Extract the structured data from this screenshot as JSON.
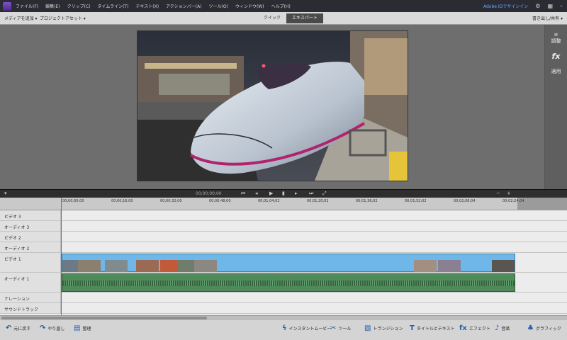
{
  "menubar": {
    "items": [
      "ファイル(F)",
      "編集(E)",
      "クリップ(C)",
      "タイムライン(T)",
      "テキスト(X)",
      "アクションバー(A)",
      "ツール(O)",
      "ウィンドウ(W)",
      "ヘルプ(H)"
    ],
    "signin": "Adobe IDでサインイン",
    "icons": [
      "settings-icon",
      "grid-icon",
      "minimize-icon"
    ]
  },
  "modebar": {
    "media_dropdown": "メディアを追加 ▾",
    "project_dropdown": "プロジェクトアセット ▾",
    "tab_quick": "クイック",
    "tab_expert": "エキスパート",
    "share_dropdown": "書き出し/共有 ▾"
  },
  "right_tools": {
    "adjust": "調整",
    "fx": "fx",
    "apply": "適用"
  },
  "transport": {
    "timecode": "00;00;00;00"
  },
  "ruler": {
    "ticks": [
      "00;00;00;00",
      "00;00;16;00",
      "00;00;32;00",
      "00;00;48;00",
      "00;01;04;02",
      "00;01;20;02",
      "00;01;36;02",
      "00;01;52;02",
      "00;02;08;04",
      "00;02;24;04"
    ]
  },
  "tracks": [
    {
      "label": "ビデオ 3"
    },
    {
      "label": "オーディオ 3"
    },
    {
      "label": "ビデオ 2"
    },
    {
      "label": "オーディオ 2"
    },
    {
      "label": "ビデオ 1"
    },
    {
      "label": "オーディオ 1"
    },
    {
      "label": "ナレーション"
    },
    {
      "label": "サウンドトラック"
    }
  ],
  "footer": {
    "undo": "元に戻す",
    "redo": "やり直し",
    "organizer": "整理",
    "instant_movie": "インスタントムービー",
    "tools": "ツール",
    "transitions": "トランジション",
    "titles": "タイトルとテキスト",
    "effects": "エフェクト",
    "audio": "音楽",
    "graphics": "グラフィック"
  },
  "colors": {
    "video_clip": "#6fb7e8",
    "audio_clip": "#4f8a5a",
    "playhead": "#e0443b",
    "expert_tab": "#4a4a4a"
  }
}
